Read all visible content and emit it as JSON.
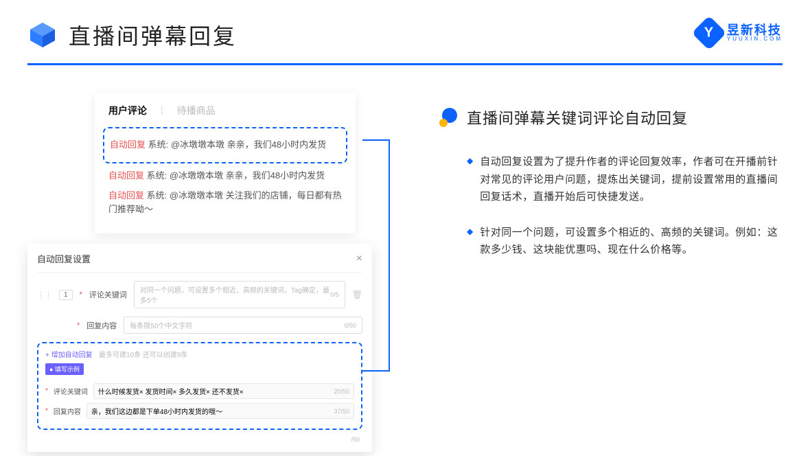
{
  "header": {
    "title": "直播间弹幕回复",
    "logo_cn": "昱新科技",
    "logo_en": "YUUXIN.COM"
  },
  "tabs": {
    "active": "用户评论",
    "inactive": "待播商品"
  },
  "comments": {
    "c1_prefix": "自动回复",
    "c1_body": " 系统: @冰墩墩本墩 亲亲，我们48小时内发货",
    "c2_prefix": "自动回复",
    "c2_body": " 系统: @冰墩墩本墩 亲亲，我们48小时内发货",
    "c3_prefix": "自动回复",
    "c3_body": " 系统: @冰墩墩本墩 关注我们的店铺，每日都有热门推荐呦～"
  },
  "settings": {
    "title": "自动回复设置",
    "row_num": "1",
    "kw_label": "评论关键词",
    "kw_placeholder": "对同一个问题，可设置多个相近、高频的关键词，Tag确定，最多5个",
    "kw_count": "0/5",
    "content_label": "回复内容",
    "content_placeholder": "每条限50个中文字符",
    "content_count": "0/50",
    "add_link": "+ 增加自动回复",
    "add_hint": "最多可建10条 还可以创建9条",
    "example_badge": "● 填写示例",
    "ex_kw_label": "评论关键词",
    "ex_kw_text": "什么时候发货× 发货时间× 多久发货× 还不发货×",
    "ex_kw_count": "20/50",
    "ex_ct_label": "回复内容",
    "ex_ct_text": "亲，我们这边都是下单48小时内发货的哦～",
    "ex_ct_count": "37/50",
    "bottom_count": "/50"
  },
  "right": {
    "heading": "直播间弹幕关键词评论自动回复",
    "b1": "自动回复设置为了提升作者的评论回复效率，作者可在开播前针对常见的评论用户问题，提炼出关键词，提前设置常用的直播间回复话术，直播开始后可快捷发送。",
    "b2": "针对同一个问题，可设置多个相近的、高频的关键词。例如：这款多少钱、这块能优惠吗、现在什么价格等。"
  }
}
